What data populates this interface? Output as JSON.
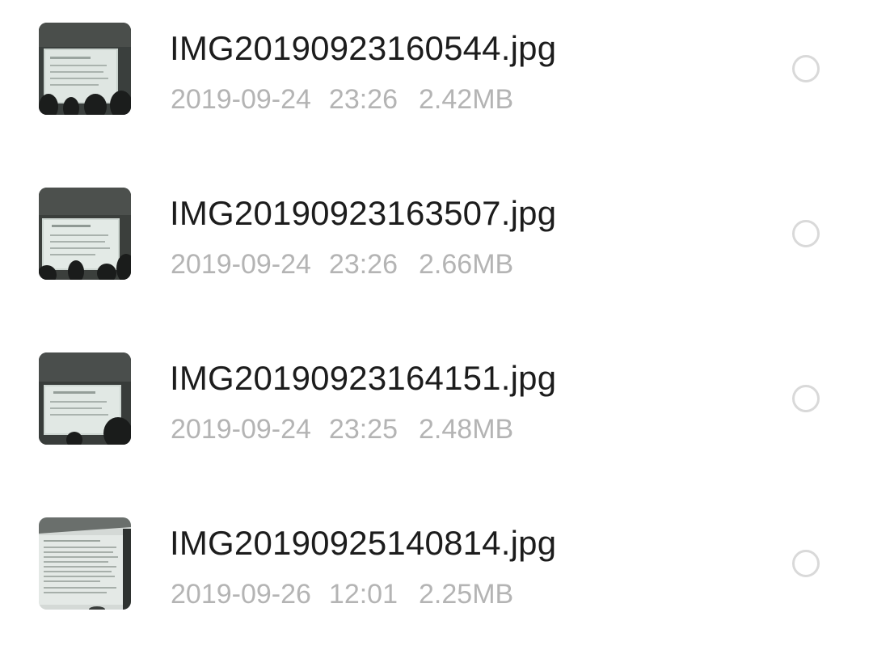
{
  "files": [
    {
      "name": "IMG20190923160544.jpg",
      "date": "2019-09-24",
      "time": "23:26",
      "size": "2.42MB",
      "thumbnail_icon": "photo-thumbnail-icon",
      "selected": false
    },
    {
      "name": "IMG20190923163507.jpg",
      "date": "2019-09-24",
      "time": "23:26",
      "size": "2.66MB",
      "thumbnail_icon": "photo-thumbnail-icon",
      "selected": false
    },
    {
      "name": "IMG20190923164151.jpg",
      "date": "2019-09-24",
      "time": "23:25",
      "size": "2.48MB",
      "thumbnail_icon": "photo-thumbnail-icon",
      "selected": false
    },
    {
      "name": "IMG20190925140814.jpg",
      "date": "2019-09-26",
      "time": "12:01",
      "size": "2.25MB",
      "thumbnail_icon": "photo-thumbnail-icon",
      "selected": false
    }
  ],
  "colors": {
    "name_text": "#1c1c1c",
    "meta_text": "#b4b4b4",
    "radio_border": "#d9d9d9",
    "background": "#ffffff"
  }
}
